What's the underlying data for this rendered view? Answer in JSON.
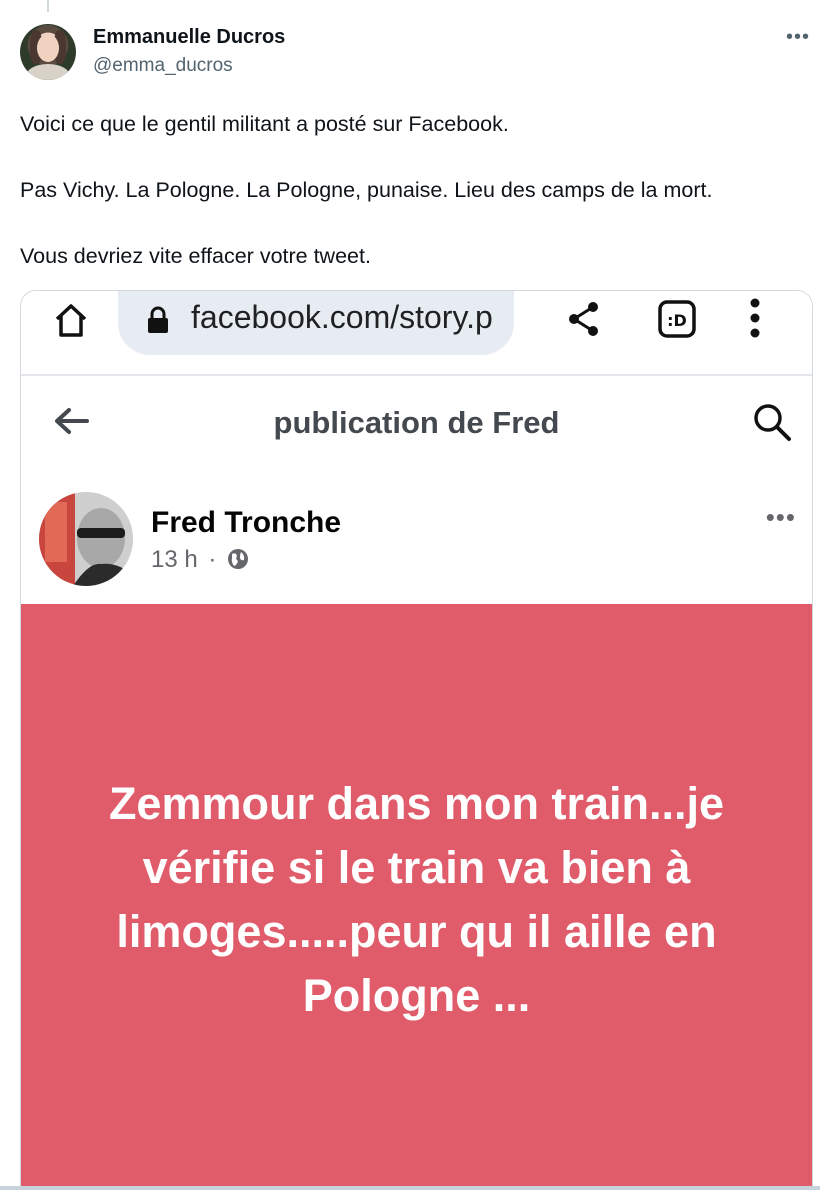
{
  "tweet": {
    "author_name": "Emmanuelle Ducros",
    "author_handle": "@emma_ducros",
    "more_icon": "more-horizontal-icon",
    "text_lines": [
      "Voici ce que le gentil militant a posté sur Facebook.",
      "Pas Vichy. La Pologne. La Pologne, punaise. Lieu des camps de la mort.",
      "Vous devriez vite effacer votre tweet."
    ]
  },
  "screenshot": {
    "browser": {
      "url": "facebook.com/story.p",
      "icons": [
        "home-icon",
        "lock-icon",
        "share-icon",
        "reader-mode-icon",
        "kebab-menu-icon"
      ]
    },
    "fb_header": {
      "title": "publication de Fred",
      "icons": [
        "back-arrow-icon",
        "search-icon"
      ]
    },
    "post": {
      "author": "Fred Tronche",
      "time": "13 h",
      "separator": "·",
      "visibility_icon": "globe-icon",
      "status_lines": [
        "Zemmour dans mon train...je",
        "vérifie si le train va bien à",
        "limoges.....peur qu il aille en",
        "Pologne ..."
      ],
      "background_color": "#e15c6b"
    }
  }
}
